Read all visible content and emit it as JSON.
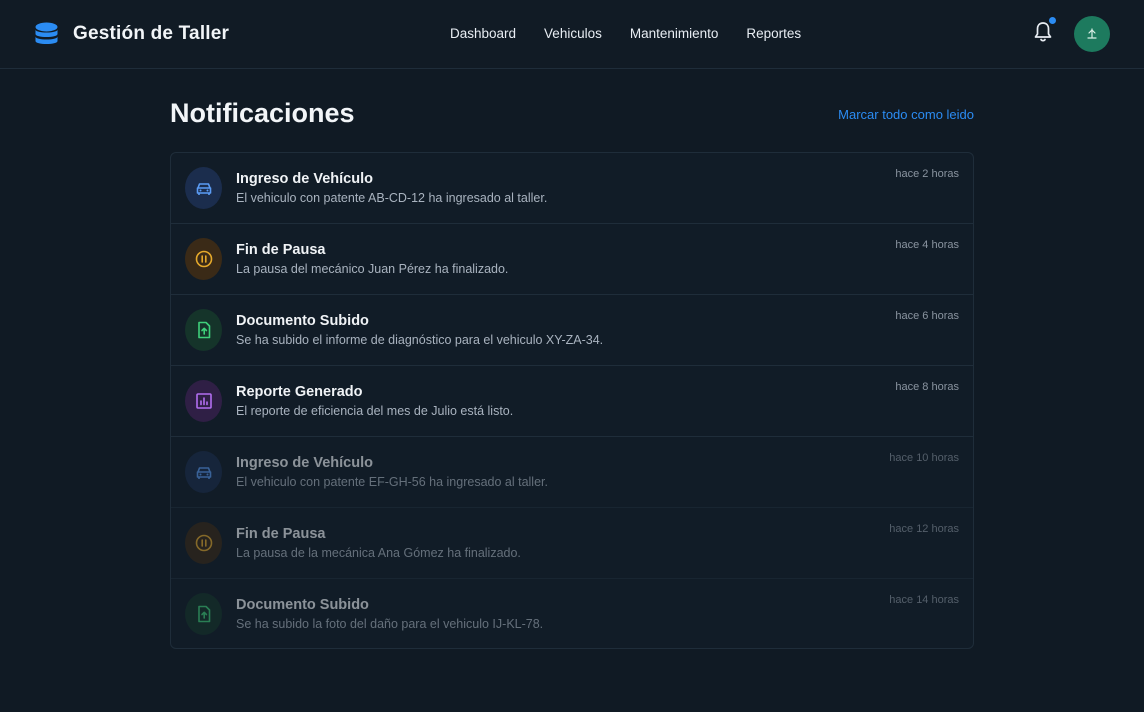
{
  "header": {
    "title": "Gestión de Taller",
    "nav": [
      "Dashboard",
      "Vehiculos",
      "Mantenimiento",
      "Reportes"
    ],
    "has_unread": true
  },
  "colors": {
    "accent": "#2b8cf3",
    "blue": "#5b9cf5",
    "amber": "#e5a92b",
    "green": "#3fcf7a",
    "purple": "#b26ef0",
    "avatar": "#1d7a5e"
  },
  "main": {
    "title": "Notificaciones",
    "mark_all": "Marcar todo como leido",
    "notifications": [
      {
        "title": "Ingreso de Vehículo",
        "desc": "El vehiculo con patente AB-CD-12 ha ingresado al taller.",
        "time": "hace 2 horas",
        "icon": "car-icon",
        "read": false
      },
      {
        "title": "Fin de Pausa",
        "desc": "La pausa del mecánico Juan Pérez ha finalizado.",
        "time": "hace 4 horas",
        "icon": "pause-icon",
        "read": false
      },
      {
        "title": "Documento Subido",
        "desc": "Se ha subido el informe de diagnóstico para el vehiculo XY-ZA-34.",
        "time": "hace 6 horas",
        "icon": "upload-file-icon",
        "read": false
      },
      {
        "title": "Reporte Generado",
        "desc": "El reporte de eficiencia del mes de Julio está listo.",
        "time": "hace 8 horas",
        "icon": "report-chart-icon",
        "read": false
      },
      {
        "title": "Ingreso de Vehículo",
        "desc": "El vehiculo con patente EF-GH-56 ha ingresado al taller.",
        "time": "hace 10 horas",
        "icon": "car-icon",
        "read": true
      },
      {
        "title": "Fin de Pausa",
        "desc": "La pausa de la mecánica Ana Gómez ha finalizado.",
        "time": "hace 12 horas",
        "icon": "pause-icon",
        "read": true
      },
      {
        "title": "Documento Subido",
        "desc": "Se ha subido la foto del daño para el vehiculo IJ-KL-78.",
        "time": "hace 14 horas",
        "icon": "upload-file-icon",
        "read": true
      }
    ]
  }
}
